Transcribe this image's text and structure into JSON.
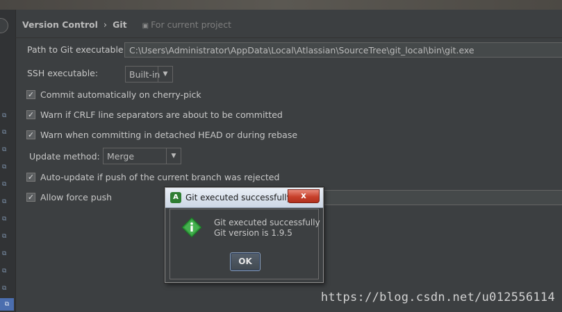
{
  "breadcrumb": {
    "parent": "Version Control",
    "separator": "›",
    "current": "Git",
    "scope": "For current project"
  },
  "fields": {
    "path_label": "Path to Git executable:",
    "path_value": "C:\\Users\\Administrator\\AppData\\Local\\Atlassian\\SourceTree\\git_local\\bin\\git.exe",
    "ssh_label": "SSH executable:",
    "ssh_value": "Built-in",
    "update_label": "Update method:",
    "update_value": "Merge"
  },
  "checkboxes": [
    {
      "label": "Commit automatically on cherry-pick",
      "checked": true
    },
    {
      "label": "Warn if CRLF line separators are about to be committed",
      "checked": true
    },
    {
      "label": "Warn when committing in detached HEAD or during rebase",
      "checked": true
    },
    {
      "label": "Auto-update if push of the current branch was rejected",
      "checked": true
    },
    {
      "label": "Allow force push",
      "checked": true
    }
  ],
  "dialog": {
    "title": "Git executed successfully",
    "close": "x",
    "message_line1": "Git executed successfully",
    "message_line2": "Git version is 1.9.5",
    "ok": "OK",
    "app_icon": "android-studio-icon",
    "info_icon": "info-icon"
  },
  "check_mark": "✓",
  "dropdown_arrow": "▼",
  "watermark": "https://blog.csdn.net/u012556114",
  "colors": {
    "background": "#3c3f41",
    "selection": "#4b6eaf",
    "info_green": "#2e9a3a"
  }
}
